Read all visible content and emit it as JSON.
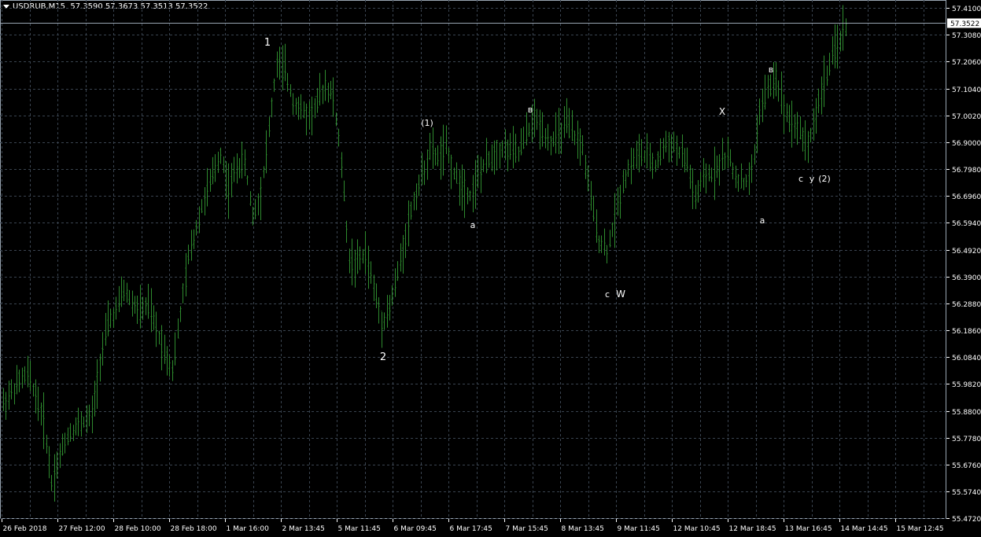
{
  "header": {
    "symbol": "USDRUB,M15",
    "ohlc": "57.3590 57.3673 57.3513 57.3522"
  },
  "colors": {
    "background": "#000000",
    "grid": "#3a4450",
    "bars": "#2e8b2e",
    "axis_text": "#ffffff",
    "price_line": "#9aa6b2",
    "current_price_box": "#ffffff",
    "current_price_text": "#000000"
  },
  "chart_data": {
    "type": "line",
    "instrument": "USDRUB",
    "timeframe": "M15",
    "title": "",
    "xlabel": "",
    "ylabel": "",
    "grid": true,
    "ylim": [
      55.47,
      57.44
    ],
    "current_price": 57.3522,
    "price_ticks": [
      "57.4100",
      "57.3080",
      "57.2060",
      "57.1040",
      "57.0020",
      "56.9000",
      "56.7980",
      "56.6960",
      "56.5940",
      "56.4920",
      "56.3900",
      "56.2880",
      "56.1860",
      "56.0840",
      "55.9820",
      "55.8800",
      "55.7780",
      "55.6760",
      "55.5740",
      "55.4720"
    ],
    "time_labels": [
      "26 Feb 2018",
      "27 Feb 12:00",
      "28 Feb 10:00",
      "28 Feb 18:00",
      "1 Mar 16:00",
      "2 Mar 13:45",
      "5 Mar 11:45",
      "6 Mar 09:45",
      "6 Mar 17:45",
      "7 Mar 15:45",
      "8 Mar 13:45",
      "9 Mar 11:45",
      "12 Mar 10:45",
      "12 Mar 18:45",
      "13 Mar 16:45",
      "14 Mar 14:45",
      "15 Mar 12:45"
    ],
    "series": [
      {
        "values": [
          55.91,
          55.95,
          55.99,
          56.02,
          55.94,
          55.84,
          55.61,
          55.71,
          55.79,
          55.82,
          55.84,
          55.86,
          56.07,
          56.21,
          56.26,
          56.34,
          56.29,
          56.26,
          56.28,
          56.19,
          56.11,
          56.04,
          56.25,
          56.46,
          56.58,
          56.69,
          56.77,
          56.86,
          56.72,
          56.81,
          56.82,
          56.62,
          56.71,
          56.95,
          57.2,
          57.17,
          57.06,
          57.02,
          57.0,
          57.05,
          57.12,
          57.07,
          56.82,
          56.45,
          56.44,
          56.48,
          56.35,
          56.22,
          56.27,
          56.4,
          56.55,
          56.68,
          56.77,
          56.87,
          56.84,
          56.88,
          56.78,
          56.74,
          56.7,
          56.77,
          56.82,
          56.86,
          56.88,
          56.87,
          56.86,
          56.93,
          56.99,
          56.95,
          56.9,
          56.93,
          56.97,
          56.92,
          56.88,
          56.68,
          56.53,
          56.49,
          56.61,
          56.75,
          56.82,
          56.86,
          56.84,
          56.81,
          56.88,
          56.9,
          56.86,
          56.82,
          56.68,
          56.76,
          56.78,
          56.82,
          56.85,
          56.77,
          56.74,
          56.78,
          57.02,
          57.1,
          57.15,
          57.03,
          56.98,
          56.94,
          56.89,
          57.01,
          57.13,
          57.22,
          57.3,
          57.35
        ]
      }
    ],
    "annotations": [
      {
        "text": "1",
        "x": "2 Mar",
        "y": 57.35
      },
      {
        "text": "2",
        "x": "6 Mar",
        "y": 56.08
      },
      {
        "text": "(1)",
        "x": "6 Mar",
        "y": 57.03
      },
      {
        "text": "a",
        "x": "7 Mar",
        "y": 56.63
      },
      {
        "text": "в",
        "x": "8 Mar",
        "y": 57.08
      },
      {
        "text": "c",
        "x": "12 Mar",
        "y": 56.34
      },
      {
        "text": "W",
        "x": "12 Mar",
        "y": 56.35
      },
      {
        "text": "X",
        "x": "13 Mar",
        "y": 57.08
      },
      {
        "text": "a",
        "x": "14 Mar",
        "y": 56.65
      },
      {
        "text": "в",
        "x": "14 Mar",
        "y": 57.23
      },
      {
        "text": "c",
        "x": "14 Mar",
        "y": 56.8
      },
      {
        "text": "y",
        "x": "15 Mar",
        "y": 56.8
      },
      {
        "text": "(2)",
        "x": "15 Mar",
        "y": 56.8
      }
    ]
  }
}
